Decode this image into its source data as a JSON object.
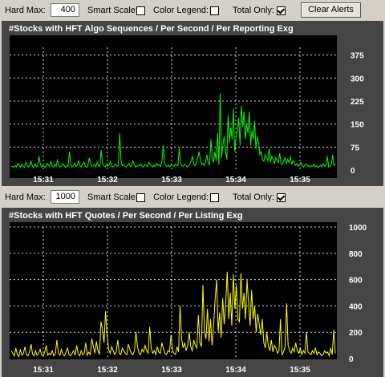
{
  "controls1": {
    "hard_max_label": "Hard Max:",
    "hard_max_value": "400",
    "smart_scale_label": "Smart Scale:",
    "color_legend_label": "Color Legend:",
    "total_only_label": "Total Only:",
    "clear_alerts_label": "Clear Alerts"
  },
  "controls2": {
    "hard_max_label": "Hard Max:",
    "hard_max_value": "1000",
    "smart_scale_label": "Smart Scale:",
    "color_legend_label": "Color Legend:",
    "total_only_label": "Total Only:"
  },
  "chart_data": [
    {
      "type": "line",
      "title": "#Stocks with HFT Algo Sequences / Per Second / Per Reporting Exg",
      "color": "#00ff00",
      "ylim": [
        0,
        400
      ],
      "yticks": [
        "375",
        "300",
        "225",
        "150",
        "75",
        "0"
      ],
      "xticks": [
        "15:31",
        "15:32",
        "15:33",
        "15:34",
        "15:35"
      ],
      "grid": true,
      "values": [
        10,
        12,
        8,
        15,
        10,
        22,
        14,
        9,
        18,
        12,
        8,
        25,
        16,
        10,
        14,
        30,
        12,
        9,
        20,
        11,
        15,
        45,
        18,
        10,
        14,
        12,
        8,
        22,
        16,
        12,
        28,
        14,
        10,
        18,
        12,
        35,
        16,
        10,
        12,
        20,
        14,
        8,
        15,
        12,
        60,
        18,
        10,
        14,
        22,
        12,
        16,
        30,
        14,
        10,
        18,
        26,
        12,
        9,
        15,
        40,
        20,
        12,
        14,
        18,
        10,
        25,
        14,
        12,
        65,
        22,
        14,
        10,
        18,
        12,
        16,
        28,
        12,
        10,
        14,
        20,
        12,
        16,
        120,
        30,
        14,
        18,
        12,
        10,
        16,
        22,
        12,
        14,
        30,
        18,
        10,
        12,
        16,
        14,
        20,
        12,
        10,
        18,
        14,
        12,
        26,
        18,
        14,
        10,
        16,
        12,
        22,
        14,
        18,
        12,
        30,
        80,
        20,
        14,
        12,
        16,
        10,
        18,
        14,
        12,
        20,
        16,
        14,
        70,
        22,
        14,
        12,
        18,
        16,
        10,
        14,
        20,
        30,
        45,
        18,
        14,
        24,
        40,
        60,
        35,
        18,
        22,
        15,
        28,
        50,
        20,
        18,
        100,
        40,
        25,
        60,
        30,
        120,
        18,
        250,
        40,
        80,
        110,
        60,
        35,
        180,
        90,
        140,
        100,
        200,
        60,
        110,
        130,
        170,
        80,
        210,
        140,
        190,
        100,
        150,
        120,
        190,
        80,
        130,
        100,
        160,
        70,
        110,
        90,
        50,
        60,
        35,
        28,
        50,
        40,
        30,
        70,
        25,
        45,
        35,
        20,
        40,
        30,
        25,
        55,
        22,
        18,
        30,
        40,
        20,
        35,
        25,
        45,
        18,
        30,
        22,
        15,
        20,
        12,
        18,
        25,
        14,
        10,
        16,
        20,
        12,
        15,
        10,
        14,
        12,
        18,
        10,
        14,
        8,
        12,
        16,
        10,
        20,
        12,
        14,
        45,
        10,
        12,
        18,
        50,
        15,
        20
      ]
    },
    {
      "type": "line",
      "title": "#Stocks with HFT Quotes / Per Second / Per Listing Exg",
      "color": "#ffff00",
      "ylim": [
        0,
        1000
      ],
      "yticks": [
        "1000",
        "800",
        "600",
        "400",
        "200",
        "0"
      ],
      "xticks": [
        "15:31",
        "15:32",
        "15:33",
        "15:34",
        "15:35"
      ],
      "grid": true,
      "values": [
        60,
        40,
        20,
        80,
        30,
        15,
        70,
        25,
        40,
        90,
        30,
        20,
        50,
        110,
        35,
        20,
        60,
        25,
        40,
        70,
        30,
        20,
        50,
        100,
        25,
        40,
        30,
        60,
        20,
        35,
        140,
        40,
        25,
        70,
        30,
        20,
        50,
        80,
        30,
        20,
        40,
        60,
        25,
        100,
        35,
        20,
        60,
        30,
        40,
        120,
        25,
        50,
        30,
        150,
        90,
        40,
        130,
        60,
        30,
        280,
        220,
        120,
        360,
        180,
        70,
        40,
        90,
        60,
        30,
        50,
        140,
        40,
        30,
        80,
        60,
        40,
        30,
        110,
        70,
        40,
        30,
        60,
        200,
        90,
        40,
        30,
        70,
        50,
        100,
        60,
        40,
        240,
        80,
        40,
        60,
        30,
        90,
        50,
        40,
        120,
        80,
        40,
        30,
        60,
        50,
        180,
        60,
        40,
        30,
        90,
        50,
        400,
        150,
        80,
        120,
        60,
        100,
        200,
        90,
        60,
        140,
        100,
        80,
        330,
        120,
        90,
        560,
        200,
        150,
        380,
        130,
        300,
        100,
        250,
        450,
        600,
        200,
        350,
        160,
        460,
        260,
        420,
        660,
        300,
        500,
        250,
        640,
        380,
        560,
        300,
        280,
        650,
        380,
        500,
        300,
        600,
        420,
        250,
        520,
        300,
        400,
        200,
        340,
        260,
        180,
        300,
        120,
        80,
        200,
        100,
        60,
        140,
        50,
        100,
        80,
        40,
        60,
        300,
        30,
        50,
        90,
        420,
        100,
        60,
        40,
        80,
        50,
        120,
        60,
        40,
        80,
        30,
        60,
        40,
        200,
        50,
        40,
        30,
        60,
        40,
        80,
        30,
        50,
        40,
        20,
        30,
        60,
        40,
        50,
        20,
        80,
        30,
        220,
        40
      ]
    }
  ]
}
